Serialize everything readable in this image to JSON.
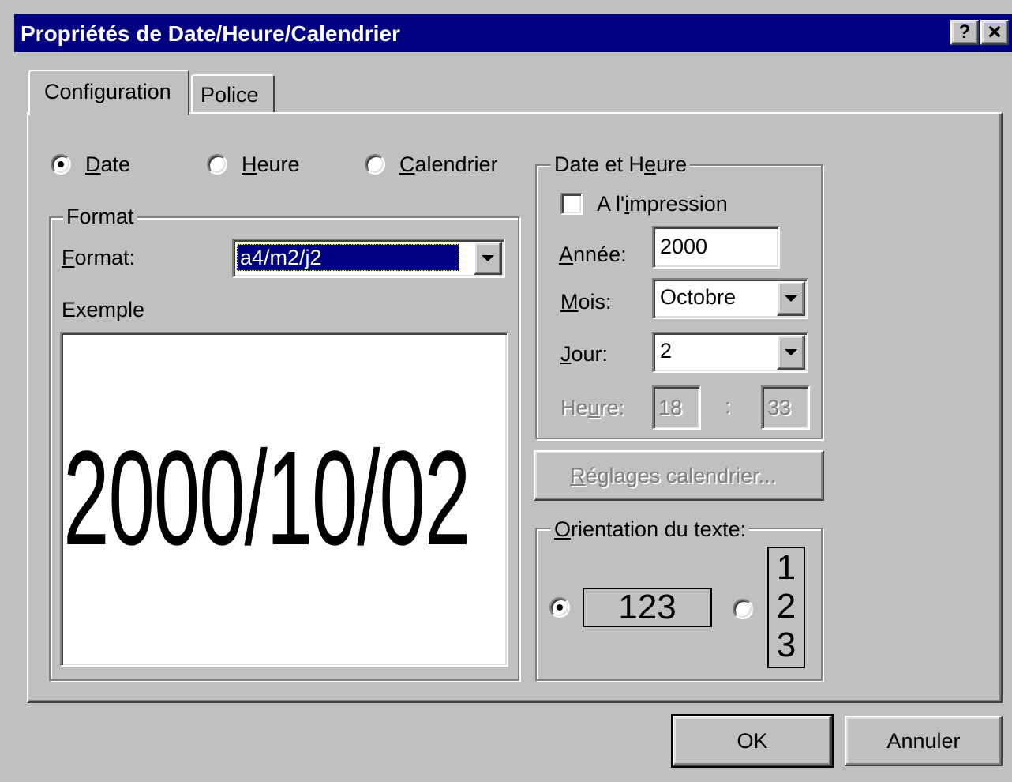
{
  "window": {
    "title": "Propriétés de Date/Heure/Calendrier",
    "help_button": "?",
    "close_button": "×"
  },
  "tabs": [
    {
      "label": "Configuration",
      "selected": true
    },
    {
      "label": "Police",
      "selected": false
    }
  ],
  "mode_radios": [
    {
      "label": "Date",
      "accel": "D",
      "rest": "ate",
      "checked": true
    },
    {
      "label": "Heure",
      "accel": "H",
      "rest": "eure",
      "checked": false
    },
    {
      "label": "Calendrier",
      "accel": "C",
      "rest": "alendrier",
      "checked": false
    }
  ],
  "format_group": {
    "title": "Format",
    "format_label_accel": "F",
    "format_label_rest": "ormat:",
    "format_value": "a4/m2/j2",
    "example_label": "Exemple",
    "example_value": "2000/10/02"
  },
  "datetime_group": {
    "title_pre": "Date et H",
    "title_accel": "e",
    "title_post": "ure",
    "print_checkbox": {
      "pre": "A l'",
      "accel": "i",
      "post": "mpression",
      "checked": false
    },
    "year_label_accel": "A",
    "year_label_rest": "nnée:",
    "year_value": "2000",
    "month_label_accel": "M",
    "month_label_rest": "ois:",
    "month_value": "Octobre",
    "day_label_accel": "J",
    "day_label_rest": "our:",
    "day_value": "2",
    "hour_label_pre": "He",
    "hour_label_accel": "u",
    "hour_label_post": "re:",
    "hour_value": "18",
    "separator": ":",
    "minute_value": "33"
  },
  "calendar_settings_button": {
    "accel": "R",
    "rest": "églages calendrier..."
  },
  "orientation_group": {
    "title_accel": "O",
    "title_rest": "rientation du texte:",
    "horizontal_sample": "123",
    "vertical_sample": [
      "1",
      "2",
      "3"
    ],
    "horizontal_checked": true
  },
  "buttons": {
    "ok": "OK",
    "cancel": "Annuler"
  },
  "colors": {
    "titlebar": "#000080",
    "face": "#c0c0c0",
    "selection": "#000080"
  }
}
